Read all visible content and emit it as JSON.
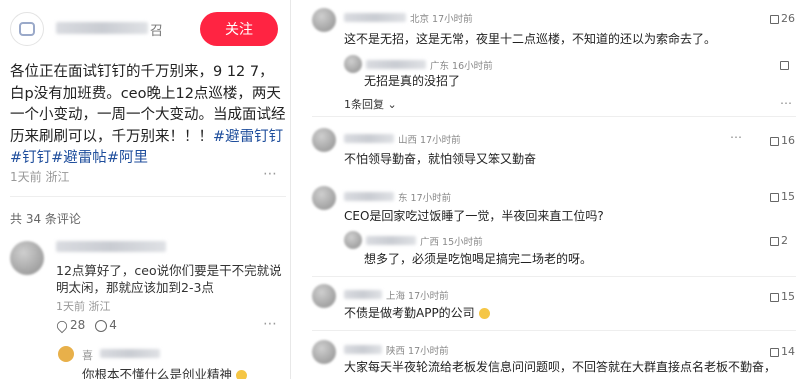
{
  "left": {
    "follow_label": "关注",
    "author_tail": "召",
    "post_text_plain": "各位正在面试钉钉的千万别来，9 12 7，白p没有加班费。ceo晚上12点巡楼，两天一个小变动，一周一个大变动。当成面试经历来刷刷可以，千万别来！！！",
    "hashtags": [
      "#避雷钉钉",
      "#钉钉",
      "#避雷帖",
      "#阿里"
    ],
    "meta": "1天前 浙江",
    "comment_count": "共 34 条评论",
    "comment1": {
      "text": "12点算好了，ceo说你们要是干不完就说明太闲，那就应该加到2-3点",
      "meta": "1天前 浙江",
      "likes": "28",
      "replies": "4"
    },
    "comment2": {
      "name": "喜",
      "text": "你根本不懂什么是创业精神"
    }
  },
  "right": {
    "comments": [
      {
        "loc": "北京 17小时前",
        "text": "这不是无招，这是无常，夜里十二点巡楼，不知道的还以为索命去了。",
        "likes": "26"
      },
      {
        "loc": "广东 16小时前",
        "text": "无招是真的没招了",
        "likes": ""
      },
      {
        "link": "1条回复"
      },
      {
        "loc": "山西 17小时前",
        "text": "不怕领导勤奋，就怕领导又笨又勤奋",
        "likes": "16"
      },
      {
        "loc": "东 17小时前",
        "text": "CEO是回家吃过饭睡了一觉，半夜回来直工位吗?",
        "likes": "15"
      },
      {
        "loc": "广西 15小时前",
        "text": "想多了，必须是吃饱喝足搞完二场老的呀。",
        "likes": "2"
      },
      {
        "loc": "上海 17小时前",
        "text": "不债是做考勤APP的公司",
        "likes": "15"
      },
      {
        "loc": "陕西 17小时前",
        "text": "大家每天半夜轮流给老板发信息问问题呗，不回答就在大群直接点名老板不勤奋，",
        "likes": "14"
      }
    ]
  }
}
